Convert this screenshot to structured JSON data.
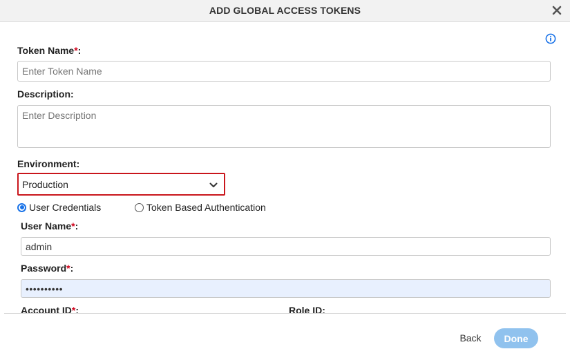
{
  "dialog": {
    "title": "ADD GLOBAL ACCESS TOKENS",
    "close_icon": "close-icon",
    "info_icon": "info-icon"
  },
  "form": {
    "token_name": {
      "label": "Token Name",
      "required_mark": "*",
      "suffix": ":",
      "placeholder": "Enter Token Name",
      "value": ""
    },
    "description": {
      "label": "Description:",
      "placeholder": "Enter Description",
      "value": ""
    },
    "environment": {
      "label": "Environment:",
      "selected": "Production"
    },
    "auth_type": {
      "options": [
        {
          "label": "User Credentials",
          "checked": true
        },
        {
          "label": "Token Based Authentication",
          "checked": false
        }
      ]
    },
    "user_name": {
      "label": "User Name",
      "required_mark": "*",
      "suffix": ":",
      "value": "admin"
    },
    "password": {
      "label": "Password",
      "required_mark": "*",
      "suffix": ":",
      "value": "••••••••••"
    },
    "account_id": {
      "label": "Account ID",
      "required_mark": "*",
      "suffix": ":"
    },
    "role_id": {
      "label": "Role ID:"
    }
  },
  "footer": {
    "back_label": "Back",
    "done_label": "Done"
  },
  "colors": {
    "required": "#d0021b",
    "accent": "#1a73e8",
    "highlight_border": "#c9161c",
    "done_button": "#90c2ee"
  }
}
